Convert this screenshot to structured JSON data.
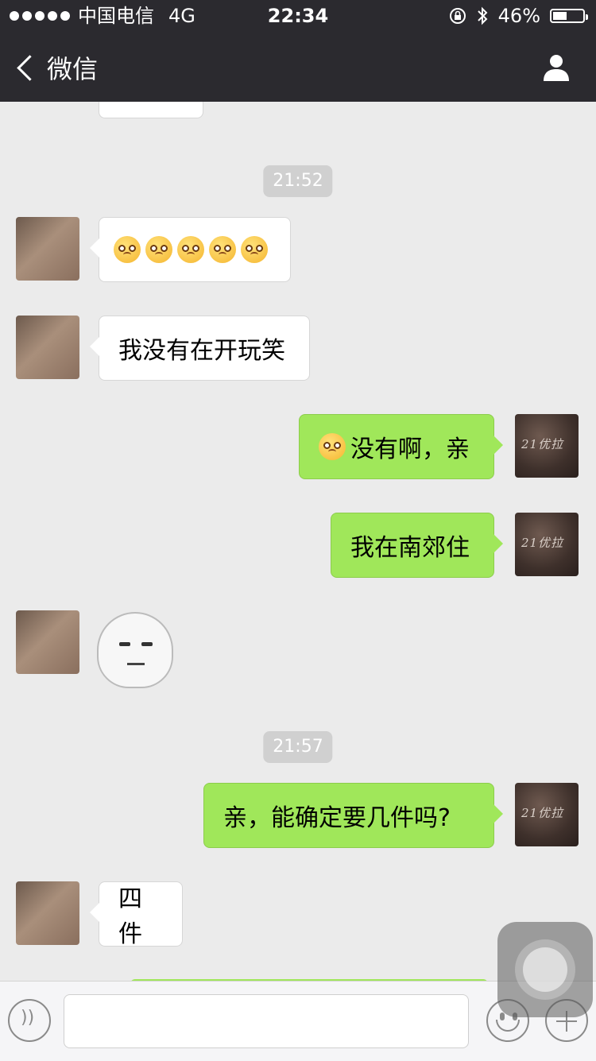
{
  "status_bar": {
    "carrier": "中国电信",
    "network": "4G",
    "time": "22:34",
    "battery": "46%",
    "battery_level": 0.46
  },
  "nav": {
    "back_label": "微信"
  },
  "timestamps": [
    "21:52",
    "21:57"
  ],
  "messages": [
    {
      "side": "in",
      "text": ""
    },
    {
      "side": "in",
      "text": "我没有在开玩笑"
    },
    {
      "side": "out",
      "text": "没有啊，亲"
    },
    {
      "side": "out",
      "text": "我在南郊住"
    },
    {
      "side": "in",
      "type": "sticker"
    },
    {
      "side": "out",
      "text": "亲，能确定要几件吗?"
    },
    {
      "side": "in",
      "text": "四件"
    }
  ],
  "avatar_logo_text": "21优拉",
  "input": {
    "value": "",
    "placeholder": ""
  },
  "icons": [
    "chevron-left-icon",
    "profile-icon",
    "voice-icon",
    "emoji-icon",
    "plus-icon",
    "lock-rotation-icon",
    "bluetooth-icon",
    "battery-icon"
  ],
  "colors": {
    "header_bg": "#2b2a2f",
    "chat_bg": "#ebebeb",
    "outgoing_bubble": "#a0e75a",
    "incoming_bubble": "#ffffff"
  }
}
